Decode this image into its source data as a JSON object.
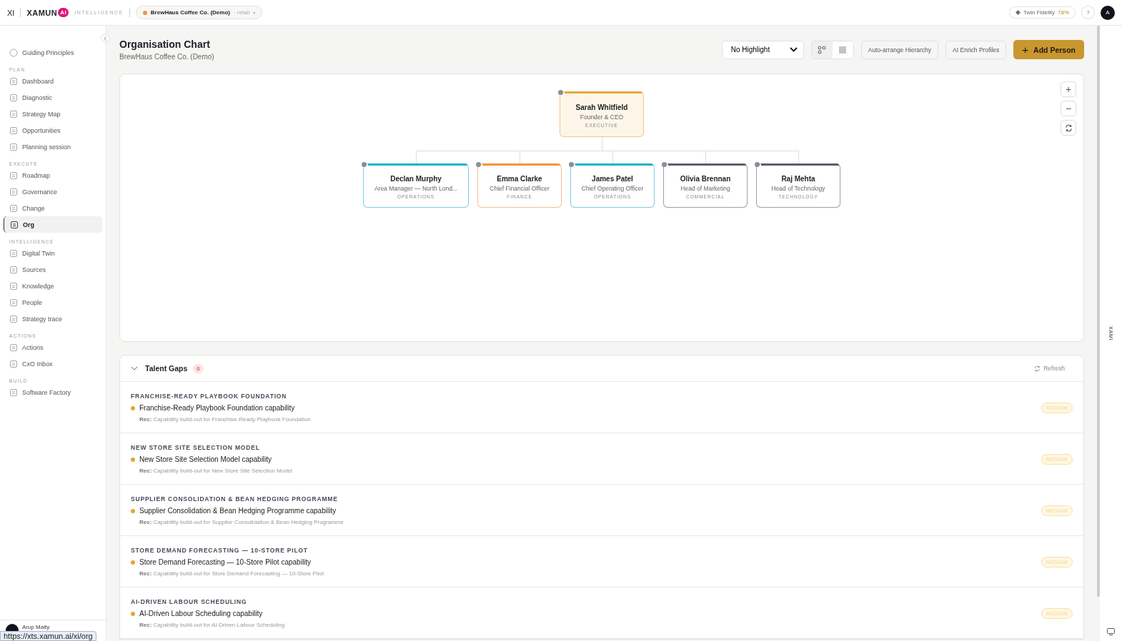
{
  "topbar": {
    "xi": "XI",
    "logo": "XAMUN",
    "logo_badge": "AI",
    "product": "INTELLIGENCE",
    "org_picker": {
      "name": "BrewHaus Coffee Co. (Demo)",
      "sector": "· retail",
      "caret": "▾"
    },
    "fidelity": {
      "label": "Twin Fidelity",
      "value": "78%"
    },
    "help": "?",
    "avatar": "A"
  },
  "sidebar": {
    "top_item": {
      "label": "Guiding Principles",
      "selected": false
    },
    "sections": [
      {
        "title": "PLAN",
        "items": [
          {
            "label": "Dashboard",
            "selected": false
          },
          {
            "label": "Diagnostic",
            "selected": false
          },
          {
            "label": "Strategy Map",
            "selected": false
          },
          {
            "label": "Opportunities",
            "selected": false
          },
          {
            "label": "Planning session",
            "selected": false
          }
        ]
      },
      {
        "title": "EXECUTE",
        "items": [
          {
            "label": "Roadmap",
            "selected": false
          },
          {
            "label": "Governance",
            "selected": false
          },
          {
            "label": "Change",
            "selected": false
          },
          {
            "label": "Org",
            "selected": true
          }
        ]
      },
      {
        "title": "INTELLIGENCE",
        "items": [
          {
            "label": "Digital Twin",
            "selected": false
          },
          {
            "label": "Sources",
            "selected": false
          },
          {
            "label": "Knowledge",
            "selected": false
          },
          {
            "label": "People",
            "selected": false
          },
          {
            "label": "Strategy trace",
            "selected": false
          }
        ]
      },
      {
        "title": "ACTIONS",
        "items": [
          {
            "label": "Actions",
            "selected": false
          },
          {
            "label": "CxO Inbox",
            "selected": false
          }
        ]
      },
      {
        "title": "BUILD",
        "items": [
          {
            "label": "Software Factory",
            "selected": false
          }
        ]
      }
    ],
    "user": "Arup Maity"
  },
  "page": {
    "title": "Organisation Chart",
    "subtitle": "BrewHaus Coffee Co. (Demo)"
  },
  "toolbar": {
    "highlight": "No Highlight",
    "views": [
      {
        "kind": "tree",
        "selected": true
      },
      {
        "kind": "grid",
        "selected": false
      }
    ],
    "buttons": [
      "Auto-arrange Hierarchy",
      "AI Enrich Profiles"
    ],
    "add": {
      "icon": "+",
      "label": "Add Person"
    }
  },
  "zoom_controls": {
    "in": "+",
    "out": "−"
  },
  "org_chart": {
    "root": {
      "name": "Sarah Whitfield",
      "role": "Founder & CEO",
      "dept": "EXECUTIVE",
      "color": "#e8a93a",
      "selected": true
    },
    "children": [
      {
        "name": "Declan Murphy",
        "role": "Area Manager — North Lond...",
        "dept": "OPERATIONS",
        "color": "#1fb0cc",
        "selected": false
      },
      {
        "name": "Emma Clarke",
        "role": "Chief Financial Officer",
        "dept": "FINANCE",
        "color": "#f0963a",
        "selected": false
      },
      {
        "name": "James Patel",
        "role": "Chief Operating Officer",
        "dept": "OPERATIONS",
        "color": "#1fb0cc",
        "selected": false
      },
      {
        "name": "Olivia Brennan",
        "role": "Head of Marketing",
        "dept": "COMMERCIAL",
        "color": "#5a5f6b",
        "selected": false
      },
      {
        "name": "Raj Mehta",
        "role": "Head of Technology",
        "dept": "TECHNOLOGY",
        "color": "#5a5f6b",
        "selected": false
      }
    ]
  },
  "talent_gaps": {
    "title": "Talent Gaps",
    "count": "6",
    "expanded": true,
    "refresh": "Refresh",
    "items": [
      {
        "heading": "FRANCHISE-READY PLAYBOOK FOUNDATION",
        "gap": "Franchise-Ready Playbook Foundation capability",
        "rec_label": "Rec:",
        "rec": "Capability build-out for Franchise-Ready Playbook Foundation",
        "priority": "MEDIUM"
      },
      {
        "heading": "NEW STORE SITE SELECTION MODEL",
        "gap": "New Store Site Selection Model capability",
        "rec_label": "Rec:",
        "rec": "Capability build-out for New Store Site Selection Model",
        "priority": "MEDIUM"
      },
      {
        "heading": "SUPPLIER CONSOLIDATION & BEAN HEDGING PROGRAMME",
        "gap": "Supplier Consolidation & Bean Hedging Programme capability",
        "rec_label": "Rec:",
        "rec": "Capability build-out for Supplier Consolidation & Bean Hedging Programme",
        "priority": "MEDIUM"
      },
      {
        "heading": "STORE DEMAND FORECASTING — 10-STORE PILOT",
        "gap": "Store Demand Forecasting — 10-Store Pilot capability",
        "rec_label": "Rec:",
        "rec": "Capability build-out for Store Demand Forecasting — 10-Store Pilot",
        "priority": "MEDIUM"
      },
      {
        "heading": "AI-DRIVEN LABOUR SCHEDULING",
        "gap": "AI-Driven Labour Scheduling capability",
        "rec_label": "Rec:",
        "rec": "Capability build-out for AI-Driven Labour Scheduling",
        "priority": "MEDIUM"
      }
    ]
  },
  "side_panel": {
    "label": "XAMI"
  },
  "status_url": "https://xts.xamun.ai/xi/org"
}
